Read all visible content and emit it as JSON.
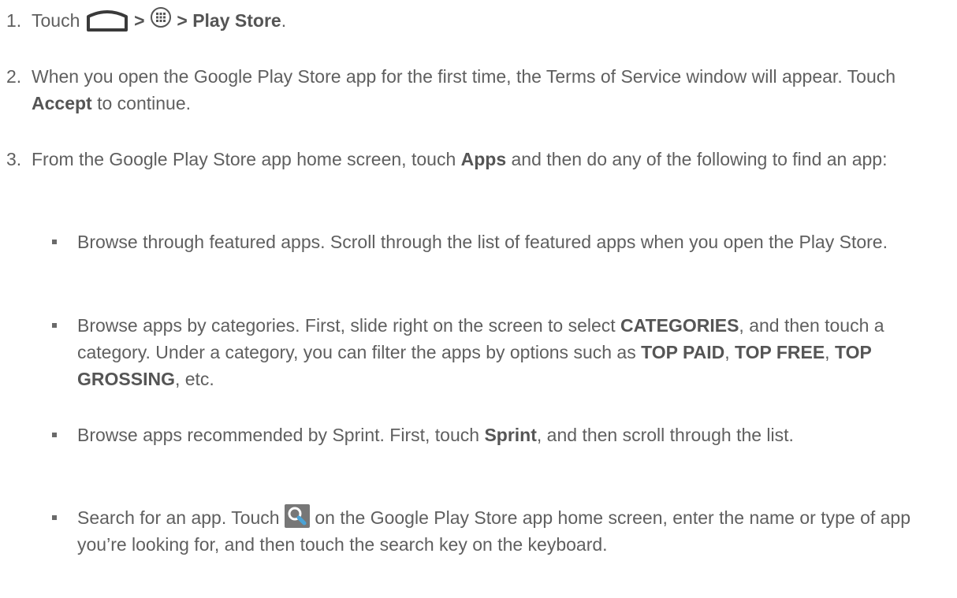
{
  "steps": [
    {
      "number": "1.",
      "touch": "Touch",
      "sep1": ">",
      "sep2": ">",
      "target": "Play Store",
      "end": "."
    },
    {
      "number": "2.",
      "text_before": "When you open the Google Play Store app for the first time, the Terms of Service window will appear. Touch",
      "bold": "Accept",
      "text_after": "to continue."
    },
    {
      "number": "3.",
      "text_before": "From the Google Play Store app home screen, touch",
      "bold": "Apps",
      "text_after": "and then do any of the following to find an app:"
    }
  ],
  "bullets": [
    {
      "text": "Browse through featured apps. Scroll through the list of featured apps when you open the Play Store."
    },
    {
      "t1": "Browse apps by categories. First, slide right on the screen to select",
      "b1": "CATEGORIES",
      "t2": ", and then touch a category. Under a category, you can filter the apps by options such as",
      "b2": "TOP PAID",
      "t3": ",",
      "b3": "TOP FREE",
      "t4": ",",
      "b4": "TOP GROSSING",
      "t5": ", etc."
    },
    {
      "t1": "Browse apps recommended by Sprint. First, touch",
      "b1": "Sprint",
      "t2": ", and then scroll through the list."
    },
    {
      "t1": "Search for an app. Touch",
      "t2": "on the Google Play Store app home screen, enter the name or type of app you’re looking for, and then touch the search key on the keyboard."
    }
  ],
  "icons": {
    "home": "home-icon",
    "apps": "all-apps-icon",
    "search": "search-icon"
  }
}
